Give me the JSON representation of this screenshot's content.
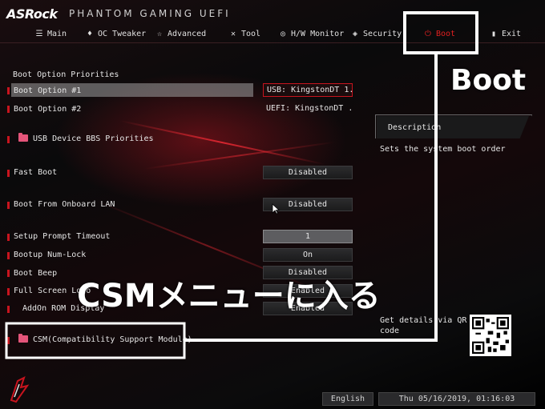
{
  "header": {
    "logo": "ASRock",
    "subtitle": "PHANTOM GAMING UEFI"
  },
  "nav": {
    "items": [
      {
        "label": "Main",
        "icon": "list-icon"
      },
      {
        "label": "OC Tweaker",
        "icon": "flame-icon"
      },
      {
        "label": "Advanced",
        "icon": "star-icon"
      },
      {
        "label": "Tool",
        "icon": "tools-icon"
      },
      {
        "label": "H/W Monitor",
        "icon": "monitor-icon"
      },
      {
        "label": "Security",
        "icon": "shield-icon"
      },
      {
        "label": "Boot",
        "icon": "power-icon",
        "active": true
      },
      {
        "label": "Exit",
        "icon": "exit-icon"
      }
    ],
    "active_color": "#e02020"
  },
  "settings": {
    "section_title": "Boot Option Priorities",
    "boot_option_1": {
      "label": "Boot Option #1",
      "value": "USB: KingstonDT 1..."
    },
    "boot_option_2": {
      "label": "Boot Option #2",
      "value": "UEFI: KingstonDT ..."
    },
    "usb_bbs": {
      "label": "USB Device BBS Priorities"
    },
    "fast_boot": {
      "label": "Fast Boot",
      "value": "Disabled"
    },
    "onboard_lan": {
      "label": "Boot From Onboard LAN",
      "value": "Disabled"
    },
    "prompt_timeout": {
      "label": "Setup Prompt Timeout",
      "value": "1"
    },
    "numlock": {
      "label": "Bootup Num-Lock",
      "value": "On"
    },
    "boot_beep": {
      "label": "Boot Beep",
      "value": "Disabled"
    },
    "full_screen_logo": {
      "label": "Full Screen Logo",
      "value": "Enabled"
    },
    "addon_rom": {
      "label": "AddOn ROM Display",
      "value": "Enabled"
    },
    "csm": {
      "label": "CSM(Compatibility Support Module)"
    }
  },
  "description": {
    "title": "Description",
    "text": "Sets the system boot order",
    "qr_text": "Get details via QR code"
  },
  "annotations": {
    "boot_callout": "Boot",
    "csm_callout": "CSMメニューに入る"
  },
  "footer": {
    "language": "English",
    "datetime": "Thu 05/16/2019, 01:16:03"
  },
  "colors": {
    "accent_red": "#c8141e",
    "folder_pink": "#e4557a"
  }
}
